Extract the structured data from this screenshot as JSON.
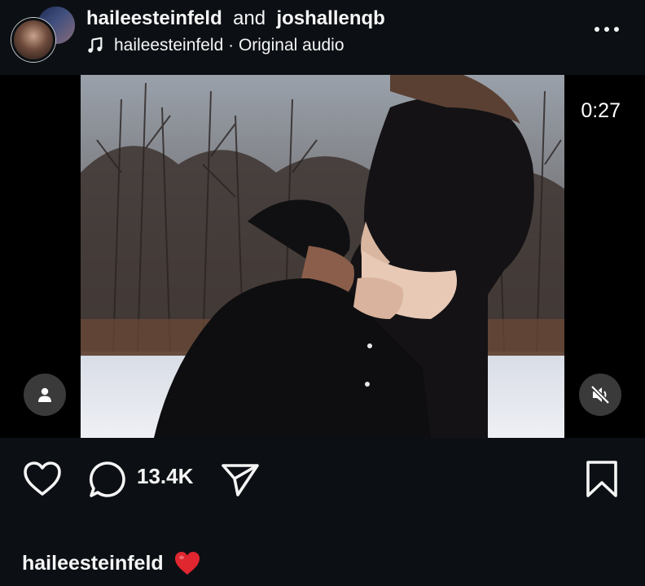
{
  "header": {
    "user1": "haileesteinfeld",
    "joiner": "and",
    "user2": "joshallenqb",
    "audio_author": "haileesteinfeld",
    "audio_sep": " · ",
    "audio_label": "Original audio"
  },
  "media": {
    "timer": "0:27"
  },
  "actions": {
    "comment_count": "13.4K"
  },
  "caption": {
    "username": "haileesteinfeld"
  },
  "icons": {
    "like": "heart-outline-icon",
    "comment": "comment-bubble-icon",
    "share": "paper-plane-icon",
    "save": "bookmark-icon",
    "more": "more-horizontal-icon",
    "music": "music-note-icon",
    "user_tags": "person-icon",
    "mute": "speaker-muted-icon",
    "caption_emoji": "red-heart-emoji"
  },
  "colors": {
    "background": "#0c1014",
    "text": "#f5f5f5",
    "heart_emoji": "#e0262f"
  }
}
